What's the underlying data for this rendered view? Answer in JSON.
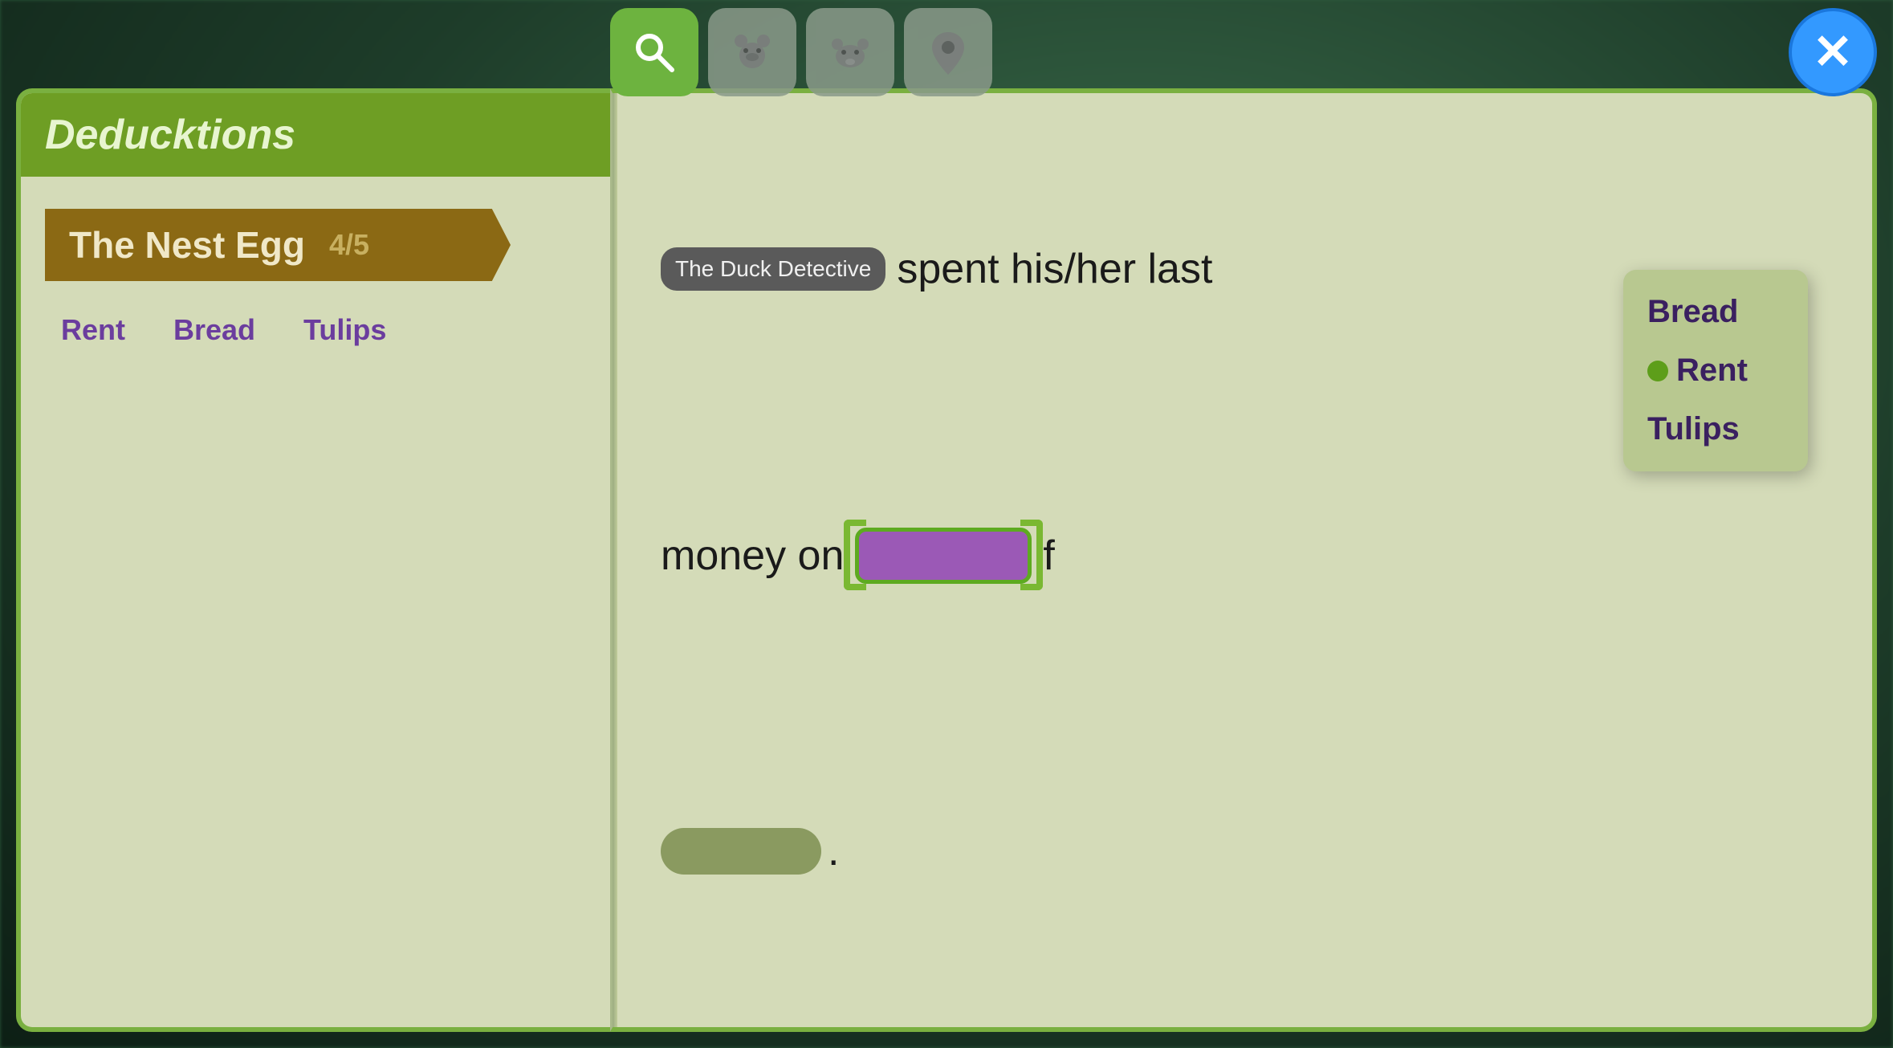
{
  "background": {
    "color": "#2d5a3d"
  },
  "toolbar": {
    "buttons": [
      {
        "id": "search",
        "label": "🔍",
        "active": true
      },
      {
        "id": "bear",
        "label": "🐻",
        "active": false
      },
      {
        "id": "cow",
        "label": "🐄",
        "active": false
      },
      {
        "id": "location",
        "label": "📍",
        "active": false
      }
    ],
    "close_label": "✕"
  },
  "left_page": {
    "header_title": "Deducktions",
    "chapter": {
      "title": "The Nest Egg",
      "count": "4/5"
    },
    "options": [
      "Rent",
      "Bread",
      "Tulips"
    ]
  },
  "right_page": {
    "detective_tag": "The Duck Detective",
    "sentence_part1": "spent his/her last",
    "sentence_part2": "money on",
    "sentence_part3": "f",
    "sentence_end": ".",
    "dropdown": {
      "items": [
        {
          "label": "Bread",
          "selected": false
        },
        {
          "label": "Rent",
          "selected": true
        },
        {
          "label": "Tulips",
          "selected": false
        }
      ]
    }
  }
}
